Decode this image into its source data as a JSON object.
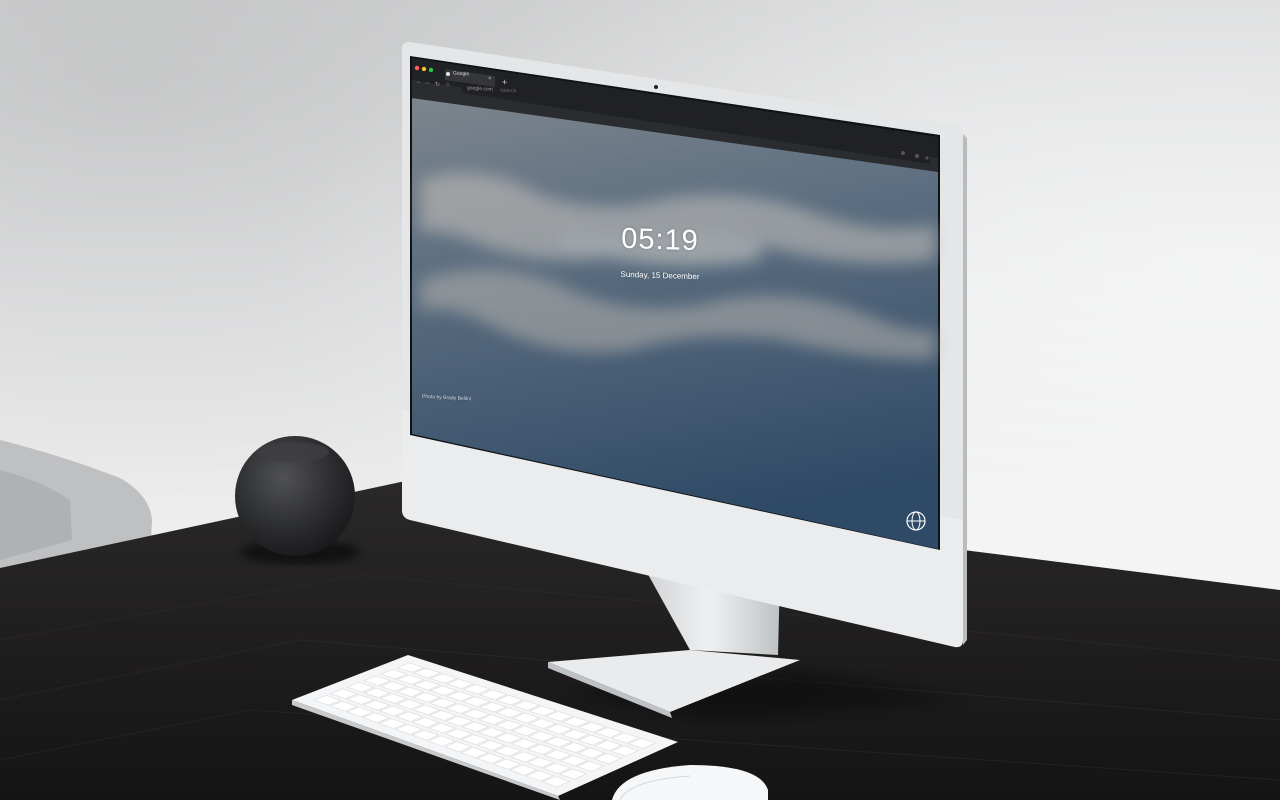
{
  "browser": {
    "tab_title": "Google",
    "tab_close": "×",
    "new_tab": "+",
    "url": "google.com",
    "url_query": "/search",
    "nav": {
      "back": "←",
      "forward": "→",
      "reload": "↻",
      "home": "⌂"
    }
  },
  "lock_screen": {
    "time": "05:19",
    "date": "Sunday, 15 December",
    "photo_credit": "Photo by Brady Bellini",
    "corner_icon": "globe-icon"
  },
  "colors": {
    "desk": "#1d1b1c",
    "monitor_body": "#e4e6e8",
    "speaker": "#2c2d2f",
    "sky": "#36506b"
  }
}
